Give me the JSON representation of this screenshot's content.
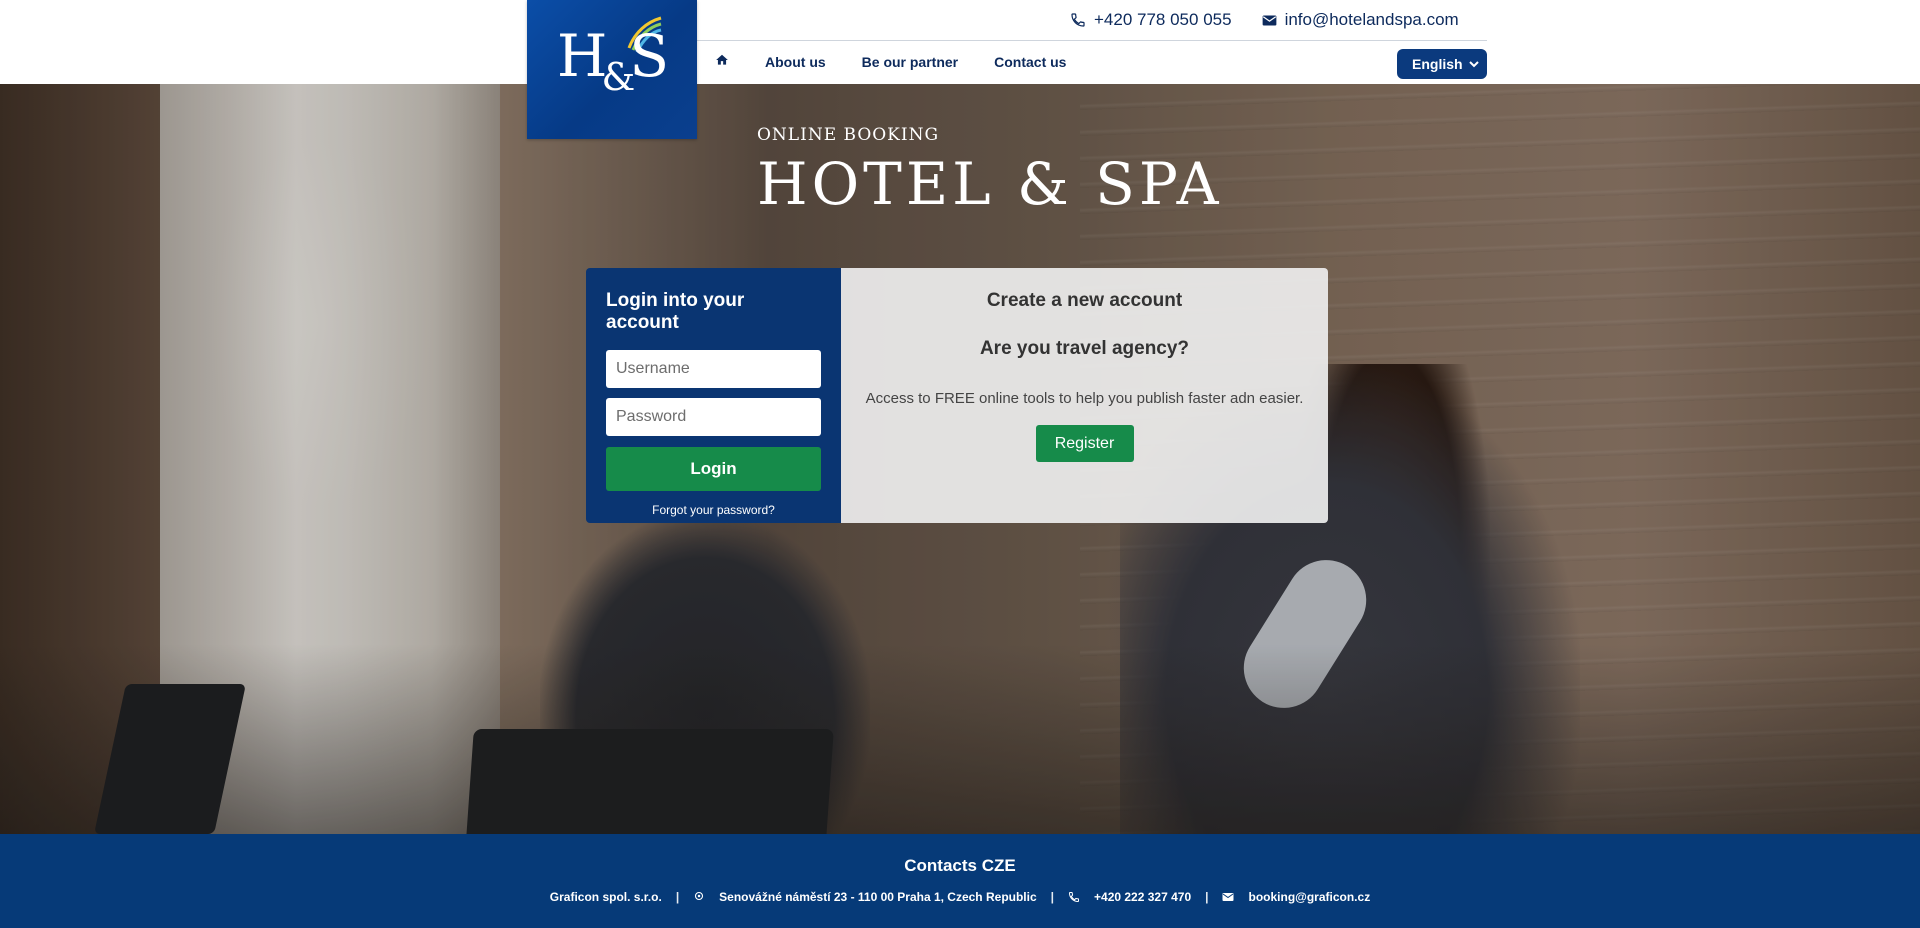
{
  "header": {
    "logo_text": "H&S",
    "phone": "+420 778 050 055",
    "email": "info@hotelandspa.com",
    "nav": [
      {
        "icon": "home-icon"
      },
      {
        "label": "About us"
      },
      {
        "label": "Be our partner"
      },
      {
        "label": "Contact us"
      }
    ],
    "language": "English"
  },
  "hero": {
    "subtitle": "ONLINE BOOKING",
    "title": "HOTEL & SPA"
  },
  "login": {
    "title": "Login into your account",
    "username_placeholder": "Username",
    "password_placeholder": "Password",
    "button": "Login",
    "forgot": "Forgot your password?"
  },
  "register": {
    "title": "Create a new account",
    "subtitle": "Are you travel agency?",
    "description": "Access to FREE online tools to help you publish faster adn easier.",
    "button": "Register"
  },
  "footer": {
    "title": "Contacts CZE",
    "company": "Graficon spol. s.r.o.",
    "address": "Senovážné náměstí 23 - 110 00 Praha 1, Czech Republic",
    "phone": "+420 222 327 470",
    "email": "booking@graficon.cz"
  },
  "colors": {
    "brand_blue": "#0a3572",
    "footer_blue": "#063a78",
    "accent_green": "#168b4a"
  }
}
